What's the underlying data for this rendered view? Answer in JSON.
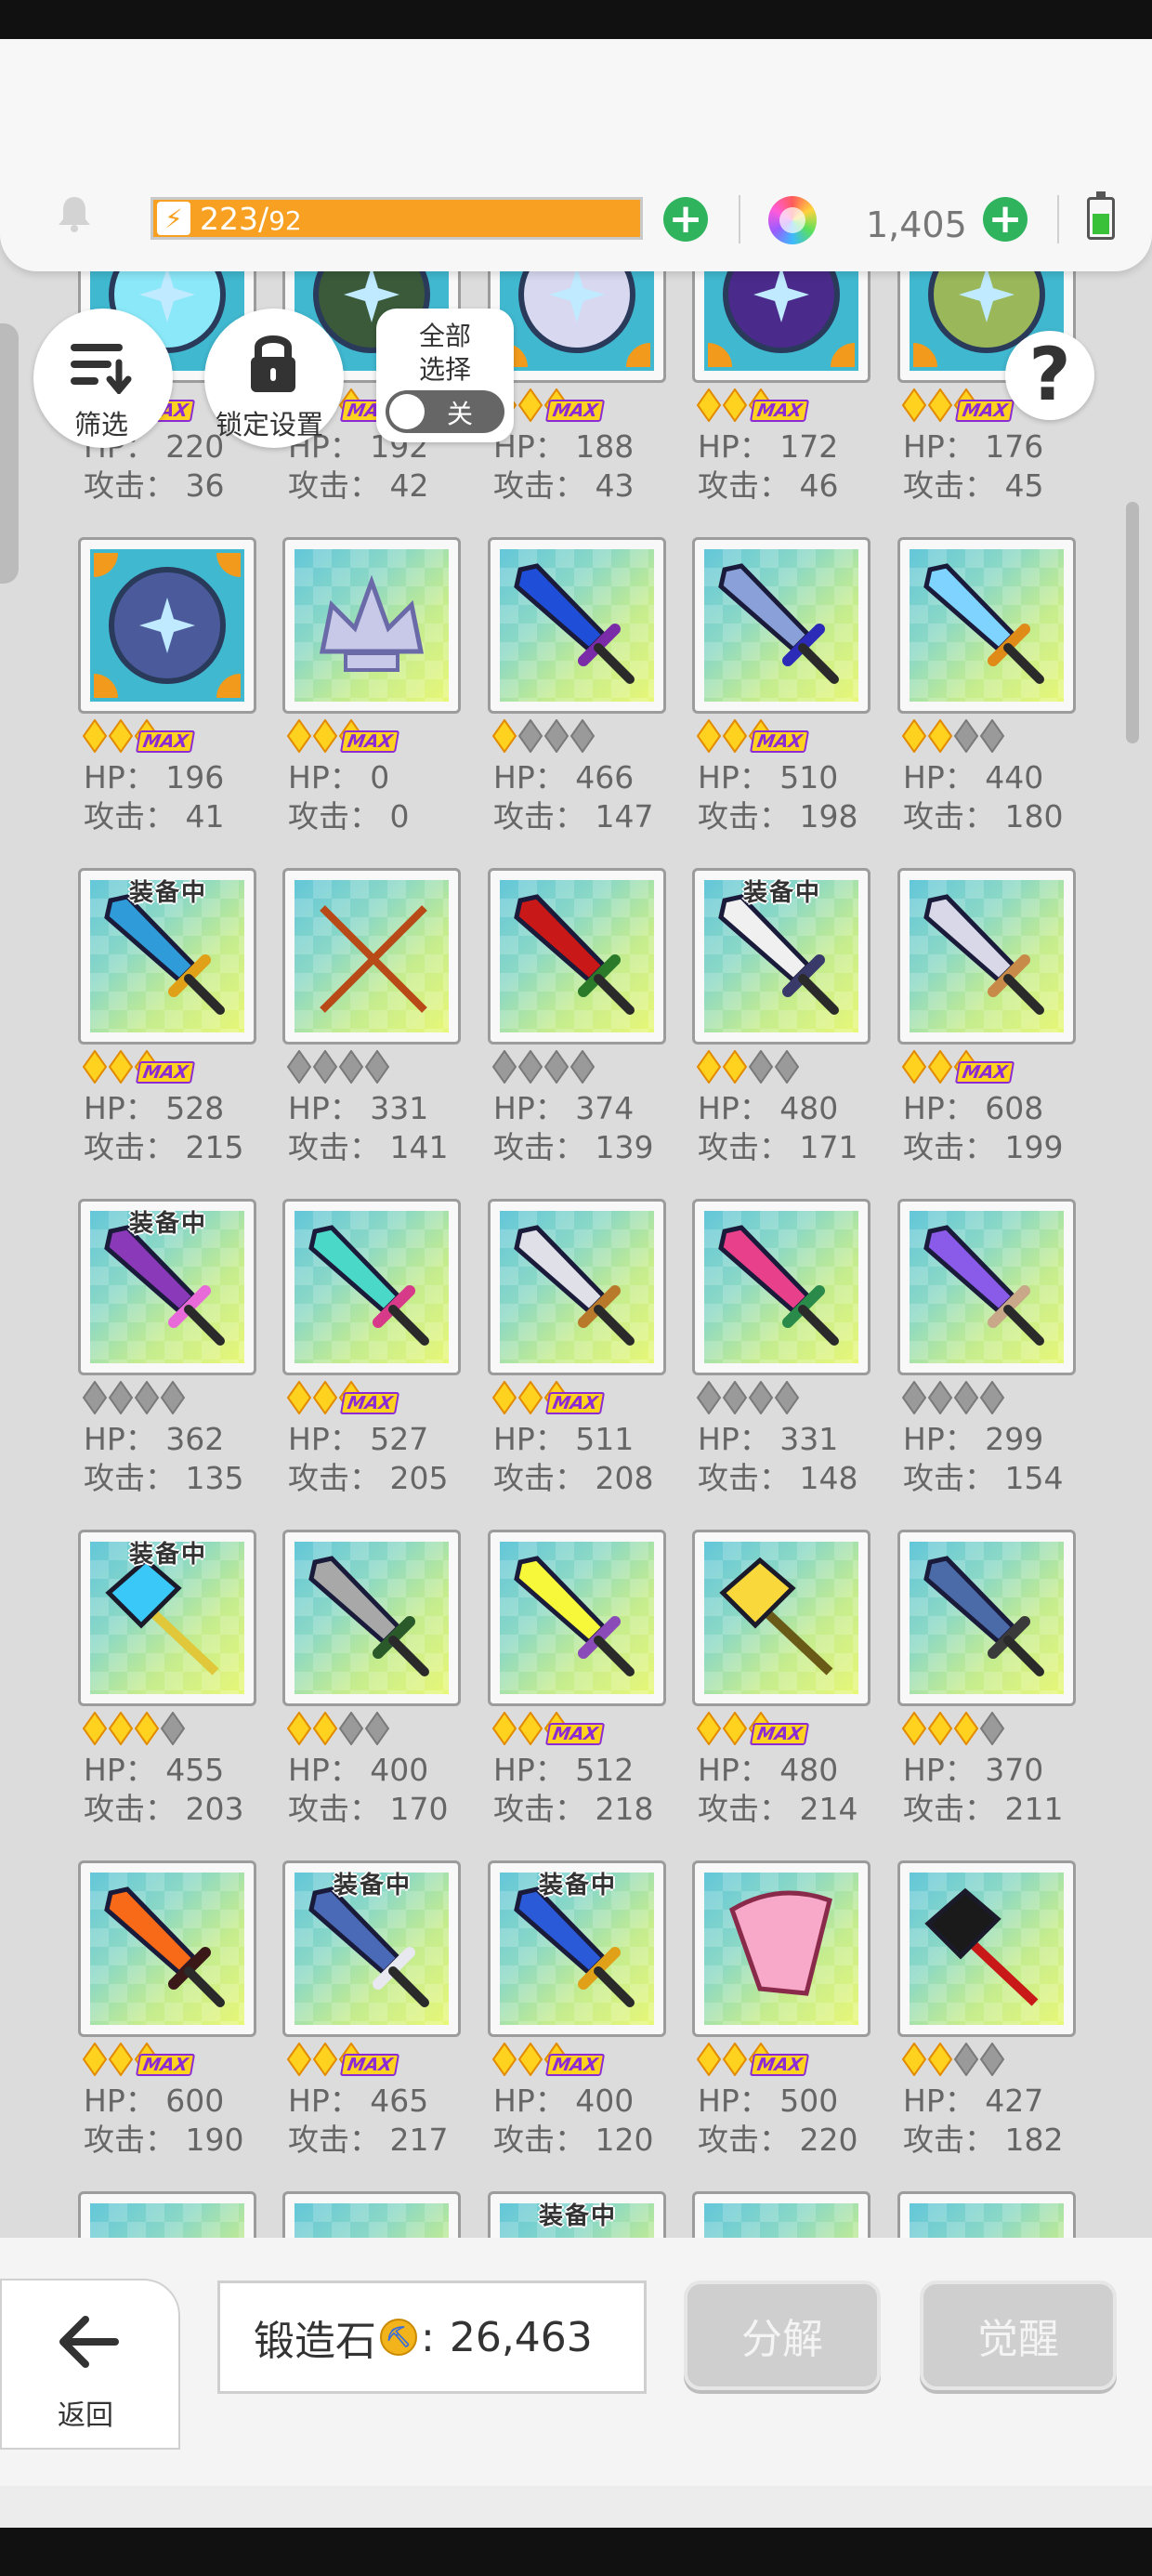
{
  "header": {
    "energy": "223/",
    "energy_max": "92",
    "gems": "1,405"
  },
  "controls": {
    "filter_label": "筛选",
    "lock_label": "锁定设置",
    "select_all_line1": "全部",
    "select_all_line2": "选择",
    "toggle_state": "关",
    "help": "?"
  },
  "stat_labels": {
    "hp": "HP：",
    "atk": "攻击："
  },
  "equipped_label": "装备中",
  "max_label": "MAX",
  "rows": [
    {
      "items": [
        {
          "stars": 2,
          "max": true,
          "hp": "220",
          "atk": "36",
          "equipped": false,
          "icon": "gem-orb"
        },
        {
          "stars": 2,
          "max": true,
          "hp": "192",
          "atk": "42",
          "equipped": false,
          "icon": "flower-orb"
        },
        {
          "stars": 2,
          "max": true,
          "hp": "188",
          "atk": "43",
          "equipped": false,
          "icon": "silver-orb"
        },
        {
          "stars": 2,
          "max": true,
          "hp": "172",
          "atk": "46",
          "equipped": false,
          "icon": "dark-orb"
        },
        {
          "stars": 2,
          "max": true,
          "hp": "176",
          "atk": "45",
          "equipped": false,
          "icon": "green-orb"
        }
      ]
    },
    {
      "items": [
        {
          "stars": 3,
          "max": true,
          "hp": "196",
          "atk": "41",
          "equipped": false,
          "icon": "compass-orb"
        },
        {
          "stars": 3,
          "max": true,
          "hp": "0",
          "atk": "0",
          "equipped": false,
          "icon": "silver-crown"
        },
        {
          "stars": 1,
          "max": false,
          "hp": "466",
          "atk": "147",
          "equipped": false,
          "icon": "blue-sword"
        },
        {
          "stars": 2,
          "max": true,
          "hp": "510",
          "atk": "198",
          "equipped": false,
          "icon": "steel-sword"
        },
        {
          "stars": 2,
          "max": false,
          "hp": "440",
          "atk": "180",
          "equipped": false,
          "icon": "rainbow-sword"
        }
      ]
    },
    {
      "items": [
        {
          "stars": 3,
          "max": true,
          "hp": "528",
          "atk": "215",
          "equipped": true,
          "icon": "ice-sword"
        },
        {
          "stars": 0,
          "max": false,
          "hp": "331",
          "atk": "141",
          "equipped": false,
          "icon": "crossed-spears"
        },
        {
          "stars": 0,
          "max": false,
          "hp": "374",
          "atk": "139",
          "equipped": false,
          "icon": "red-blade"
        },
        {
          "stars": 2,
          "max": false,
          "hp": "480",
          "atk": "171",
          "equipped": true,
          "icon": "curved-blade"
        },
        {
          "stars": 2,
          "max": true,
          "hp": "608",
          "atk": "199",
          "equipped": false,
          "icon": "great-sword"
        }
      ]
    },
    {
      "items": [
        {
          "stars": 0,
          "max": false,
          "hp": "362",
          "atk": "135",
          "equipped": true,
          "icon": "feather-blade"
        },
        {
          "stars": 2,
          "max": true,
          "hp": "527",
          "atk": "205",
          "equipped": false,
          "icon": "jade-sword"
        },
        {
          "stars": 2,
          "max": true,
          "hp": "511",
          "atk": "208",
          "equipped": false,
          "icon": "short-dagger"
        },
        {
          "stars": 0,
          "max": false,
          "hp": "331",
          "atk": "148",
          "equipped": false,
          "icon": "pink-blade"
        },
        {
          "stars": 0,
          "max": false,
          "hp": "299",
          "atk": "154",
          "equipped": false,
          "icon": "violet-sword"
        }
      ]
    },
    {
      "items": [
        {
          "stars": 3,
          "max": false,
          "hp": "455",
          "atk": "203",
          "equipped": true,
          "icon": "crystal-axe"
        },
        {
          "stars": 2,
          "max": false,
          "hp": "400",
          "atk": "170",
          "equipped": false,
          "icon": "saw-sword"
        },
        {
          "stars": 2,
          "max": true,
          "hp": "512",
          "atk": "218",
          "equipped": false,
          "icon": "lightning-sword"
        },
        {
          "stars": 2,
          "max": true,
          "hp": "480",
          "atk": "214",
          "equipped": false,
          "icon": "golden-axe"
        },
        {
          "stars": 3,
          "max": false,
          "hp": "370",
          "atk": "211",
          "equipped": false,
          "icon": "cleaver-sword"
        }
      ]
    },
    {
      "items": [
        {
          "stars": 2,
          "max": true,
          "hp": "600",
          "atk": "190",
          "equipped": false,
          "icon": "flame-sword"
        },
        {
          "stars": 2,
          "max": true,
          "hp": "465",
          "atk": "217",
          "equipped": true,
          "icon": "spear-blade"
        },
        {
          "stars": 2,
          "max": true,
          "hp": "400",
          "atk": "120",
          "equipped": true,
          "icon": "sapphire-sword"
        },
        {
          "stars": 2,
          "max": true,
          "hp": "500",
          "atk": "220",
          "equipped": false,
          "icon": "flower-fan"
        },
        {
          "stars": 2,
          "max": false,
          "hp": "427",
          "atk": "182",
          "equipped": false,
          "icon": "war-hammer"
        }
      ]
    },
    {
      "items": [
        {
          "equipped": false,
          "icon": "partial"
        },
        {
          "equipped": false,
          "icon": "partial"
        },
        {
          "equipped": true,
          "icon": "partial"
        },
        {
          "equipped": false,
          "icon": "partial"
        },
        {
          "equipped": false,
          "icon": "partial"
        }
      ]
    }
  ],
  "footer": {
    "back_label": "返回",
    "forge_label": "锻造石",
    "forge_count": "26,463",
    "dismantle_label": "分解",
    "awaken_label": "觉醒"
  },
  "colors": {
    "energy": "#f7a022",
    "plus": "#2fb35d",
    "star_gold": "#ffd21f",
    "star_gray": "#9a9a9a",
    "max_purple": "#8b2bd6",
    "frame_orange": "#f19a1b"
  }
}
